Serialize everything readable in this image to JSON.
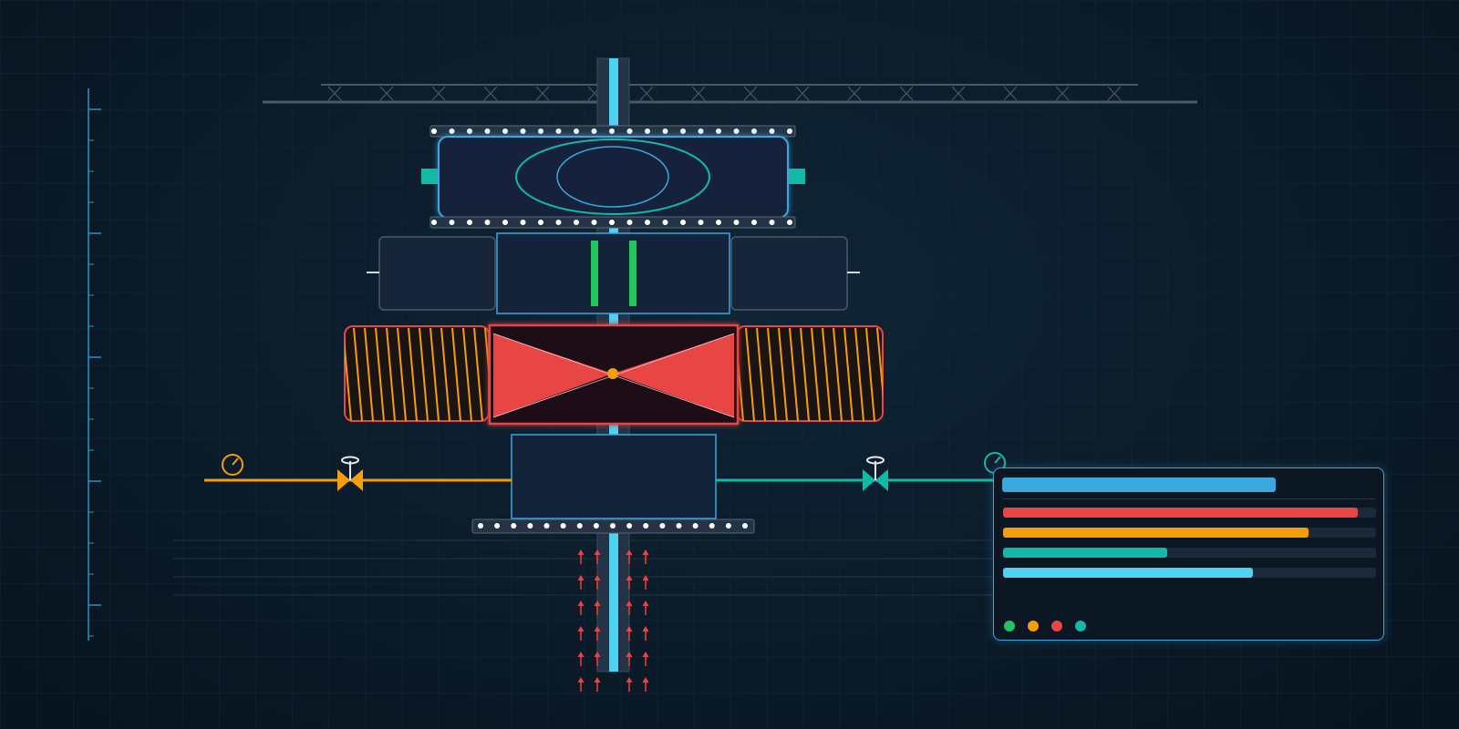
{
  "colors": {
    "background": "#0b1b29",
    "grid": "#14283a",
    "steel": "#3a4a5c",
    "shaft": "#4fd1f0",
    "cyan_outline": "#3aa7de",
    "teal": "#14b8a6",
    "green": "#22c55e",
    "red": "#e84545",
    "orange": "#f59e0b",
    "white_bolt": "#ffffff"
  },
  "icons": {
    "left_gauge": "pressure-gauge-icon",
    "left_valve": "gate-valve-icon",
    "right_valve": "gate-valve-icon",
    "right_gauge": "pressure-gauge-icon",
    "heat_arrows": "up-arrow-icon"
  },
  "status_panel": {
    "header_color": "#3aa7de",
    "gauges": [
      {
        "name": "red-gauge",
        "level": 0.95,
        "color": "#e84545"
      },
      {
        "name": "orange-gauge",
        "level": 0.82,
        "color": "#f59e0b"
      },
      {
        "name": "teal-gauge",
        "level": 0.44,
        "color": "#14b8a6"
      },
      {
        "name": "cyan-gauge",
        "level": 0.67,
        "color": "#4fd1f0"
      }
    ],
    "indicators": [
      "#22c55e",
      "#f59e0b",
      "#e84545",
      "#14b8a6"
    ]
  }
}
